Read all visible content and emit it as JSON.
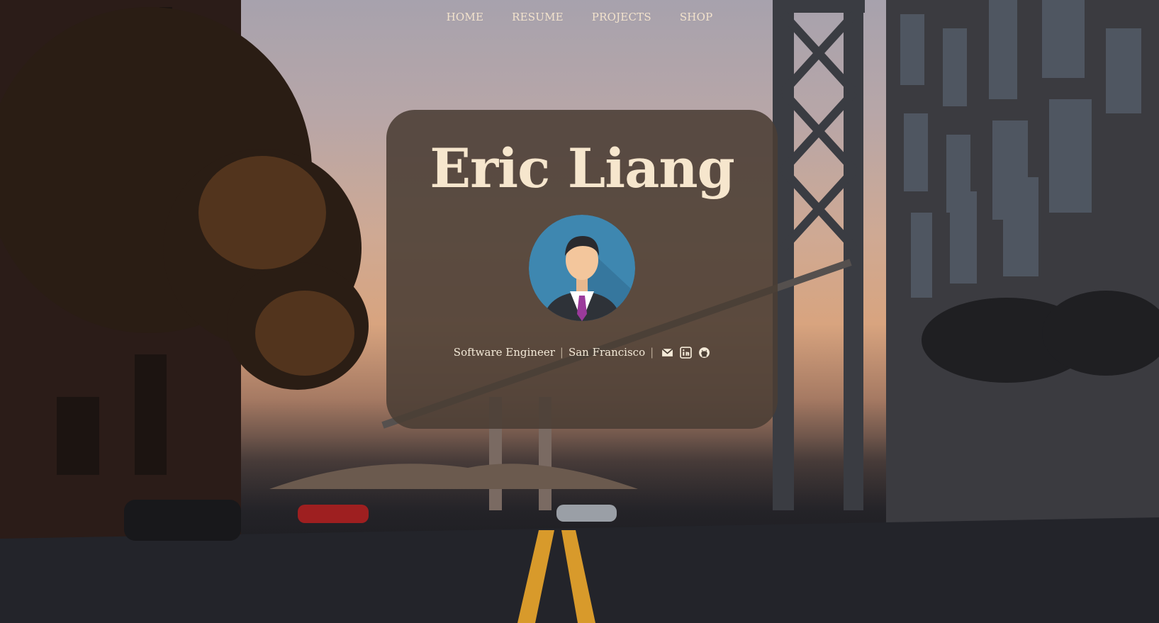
{
  "nav": {
    "items": [
      {
        "label": "HOME"
      },
      {
        "label": "RESUME"
      },
      {
        "label": "PROJECTS"
      },
      {
        "label": "SHOP"
      }
    ]
  },
  "profile": {
    "name": "Eric Liang",
    "role": "Software Engineer",
    "separator": "|",
    "location": "San Francisco",
    "icons": [
      "envelope-icon",
      "linkedin-icon",
      "github-icon"
    ]
  },
  "colors": {
    "accent_text": "#f6e6cd",
    "card_bg": "#4a3e34"
  }
}
